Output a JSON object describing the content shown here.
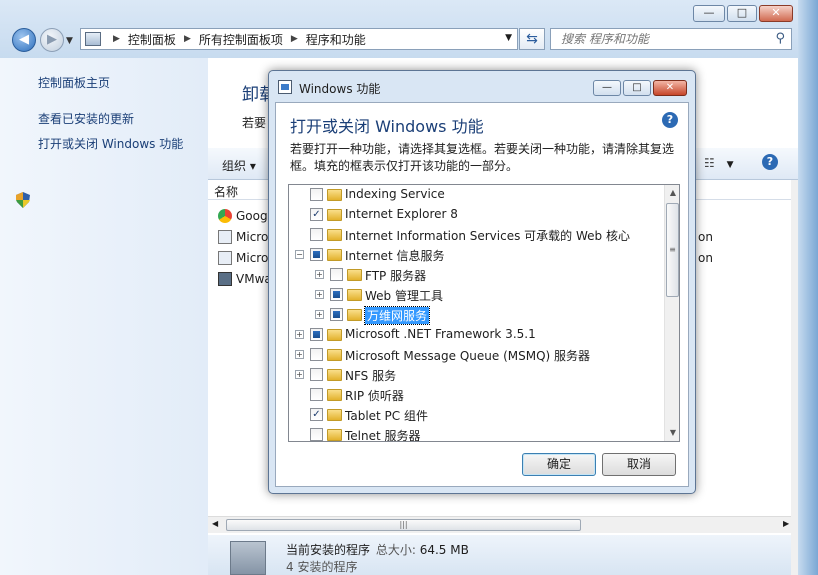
{
  "window": {
    "minimize": "—",
    "maximize": "□",
    "close": "✕"
  },
  "address": {
    "crumbs": [
      "控制面板",
      "所有控制面板项",
      "程序和功能"
    ]
  },
  "search": {
    "placeholder": "搜索 程序和功能"
  },
  "left_pane": {
    "home": "控制面板主页",
    "updates": "查看已安装的更新",
    "features": "打开或关闭 Windows 功能"
  },
  "main": {
    "title": "卸载",
    "desc": "若要",
    "organize": "组织 ▾",
    "column_name": "名称",
    "programs": [
      "Goog",
      "Micro",
      "Micro",
      "VMwa"
    ],
    "right_texts": [
      "on",
      "on"
    ],
    "status_line1": "当前安装的程序",
    "status_size_label": "总大小:",
    "status_size": "64.5 MB",
    "status_line2": "4 安装的程序"
  },
  "dialog": {
    "title": "Windows 功能",
    "heading": "打开或关闭 Windows 功能",
    "desc": "若要打开一种功能，请选择其复选框。若要关闭一种功能，请清除其复选框。填充的框表示仅打开该功能的一部分。",
    "items": [
      {
        "label": "Indexing Service",
        "state": "unchecked",
        "expand": ""
      },
      {
        "label": "Internet Explorer 8",
        "state": "checked",
        "expand": ""
      },
      {
        "label": "Internet Information Services 可承载的 Web 核心",
        "state": "unchecked",
        "expand": ""
      },
      {
        "label": "Internet 信息服务",
        "state": "partial",
        "expand": "−"
      },
      {
        "label": "FTP 服务器",
        "state": "unchecked",
        "expand": "+"
      },
      {
        "label": "Web 管理工具",
        "state": "partial",
        "expand": "+"
      },
      {
        "label": "万维网服务",
        "state": "partial",
        "expand": "+"
      },
      {
        "label": "Microsoft .NET Framework 3.5.1",
        "state": "partial",
        "expand": "+"
      },
      {
        "label": "Microsoft Message Queue (MSMQ) 服务器",
        "state": "unchecked",
        "expand": "+"
      },
      {
        "label": "NFS 服务",
        "state": "unchecked",
        "expand": "+"
      },
      {
        "label": "RIP 侦听器",
        "state": "unchecked",
        "expand": ""
      },
      {
        "label": "Tablet PC 组件",
        "state": "checked",
        "expand": ""
      },
      {
        "label": "Telnet 服务器",
        "state": "unchecked",
        "expand": ""
      }
    ],
    "ok": "确定",
    "cancel": "取消"
  }
}
